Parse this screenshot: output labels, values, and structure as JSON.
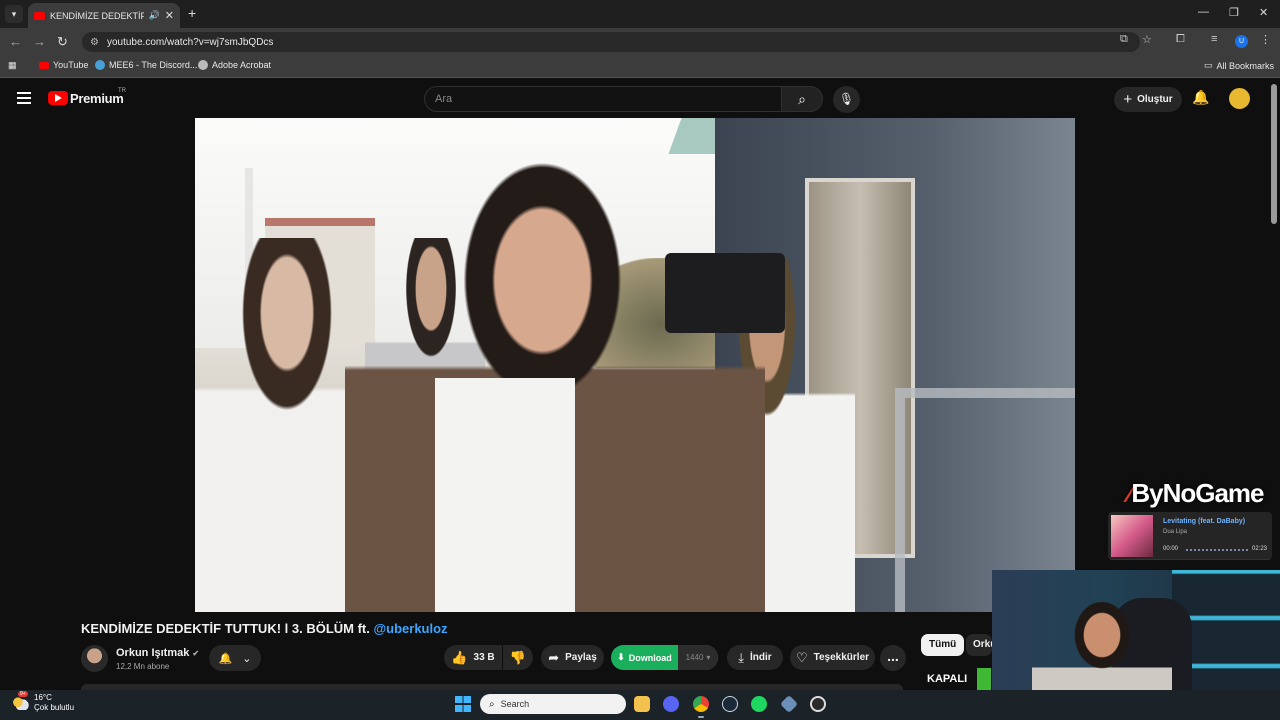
{
  "browser": {
    "tab_title": "KENDİMİZE DEDEKTİF TUTT",
    "url": "youtube.com/watch?v=wj7smJbQDcs",
    "bookmarks": [
      "YouTube",
      "MEE6 - The Discord...",
      "Adobe Acrobat"
    ],
    "all_bookmarks": "All Bookmarks",
    "profile_initial": "U"
  },
  "yt": {
    "brand": "Premium",
    "country": "TR",
    "search_placeholder": "Ara",
    "create_label": "Oluştur"
  },
  "video": {
    "title": "KENDİMİZE DEDEKTİF TUTTUK! l 3. BÖLÜM ft. ",
    "mention": "@uberkuloz",
    "channel": "Orkun Işıtmak",
    "subscribers": "12,2 Mn abone",
    "likes": "33 B",
    "share": "Paylaş",
    "download": "Download",
    "quality": "1440",
    "indir": "İndir",
    "thanks": "Teşekkürler",
    "more": "..."
  },
  "sidebar": {
    "chips": [
      "Tümü",
      "Orkun"
    ]
  },
  "overlay": {
    "logo": "ByNoGame",
    "song": "Levitating (feat. DaBaby)",
    "artist": "Dua Lipa",
    "time_start": "00:00",
    "time_end": "02:23",
    "kapali": "KAPALI"
  },
  "taskbar": {
    "temp": "16°C",
    "weather": "Çok bulutlu",
    "weather_badge": "9+",
    "search": "Search"
  },
  "colors": {
    "accent_red": "#ff0000",
    "download_green": "#1aaf5d",
    "mention_blue": "#3ea6ff"
  }
}
